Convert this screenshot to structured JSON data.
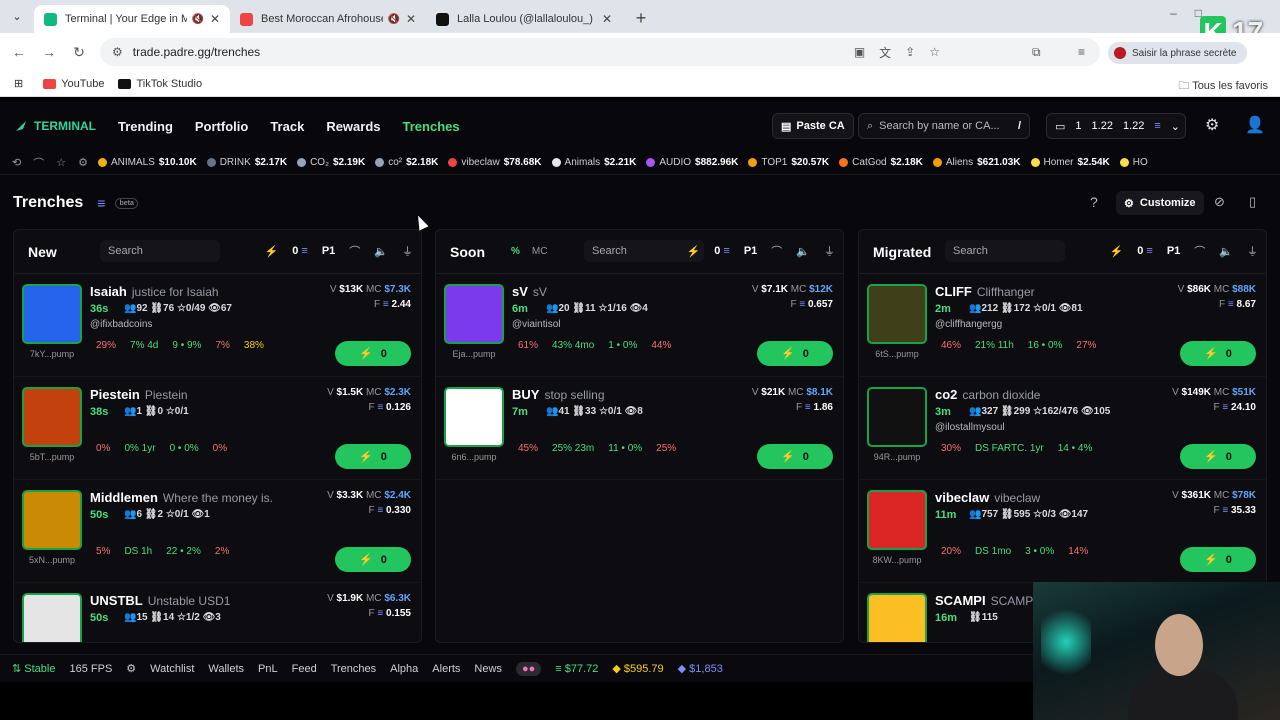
{
  "browser": {
    "tabs": [
      {
        "title": "Terminal | Your Edge in Me",
        "color": "#10b981",
        "active": true
      },
      {
        "title": "Best Moroccan Afrohouse M",
        "color": "#ef4444",
        "active": false
      },
      {
        "title": "Lalla Loulou (@lallaloulou_) est",
        "color": "#111111",
        "active": false
      }
    ],
    "url": "trade.padre.gg/trenches",
    "passkey_label": "Saisir la phrase secrète",
    "bookmarks": [
      {
        "label": "YouTube",
        "color": "#ef4444"
      },
      {
        "label": "TikTok Studio",
        "color": "#111111"
      }
    ],
    "all_bookmarks": "Tous les favoris",
    "badge_letter": "K",
    "badge_number": "17"
  },
  "app": {
    "logo": "TERMINAL",
    "nav": [
      "Trending",
      "Portfolio",
      "Track",
      "Rewards",
      "Trenches"
    ],
    "paste_label": "Paste CA",
    "search_placeholder": "Search by name or CA...",
    "search_key": "/",
    "wallet": {
      "count": "1",
      "v1": "1.22",
      "v2": "1.22"
    },
    "ticker": [
      {
        "name": "ANIMALS",
        "value": "$10.10K",
        "color": "#eab308"
      },
      {
        "name": "DRINK",
        "value": "$2.17K",
        "color": "#64748b"
      },
      {
        "name": "CO₂",
        "value": "$2.19K",
        "color": "#94a3b8"
      },
      {
        "name": "co²",
        "value": "$2.18K",
        "color": "#94a3b8"
      },
      {
        "name": "vibeclaw",
        "value": "$78.68K",
        "color": "#ef4444"
      },
      {
        "name": "Animals",
        "value": "$2.21K",
        "color": "#e5e7eb"
      },
      {
        "name": "AUDIO",
        "value": "$882.96K",
        "color": "#a855f7"
      },
      {
        "name": "TOP1",
        "value": "$20.57K",
        "color": "#f59e0b"
      },
      {
        "name": "CatGod",
        "value": "$2.18K",
        "color": "#f97316"
      },
      {
        "name": "Aliens",
        "value": "$621.03K",
        "color": "#f59e0b"
      },
      {
        "name": "Homer",
        "value": "$2.54K",
        "color": "#fde047"
      },
      {
        "name": "HO",
        "value": "",
        "color": "#fde047"
      }
    ],
    "trenches_title": "Trenches",
    "beta": "beta",
    "customize": "Customize",
    "columns": [
      {
        "title": "New",
        "search": "Search",
        "count": "0",
        "preset": "P1",
        "cards": [
          {
            "name": "Isaiah",
            "sub": "justice for Isaiah",
            "age": "36s",
            "stats": "👥92  ⛓76  ☆0/49  👁67",
            "handle": "@ifixbadcoins",
            "addr": "7kY...pump",
            "v": "$13K",
            "mc": "$7.3K",
            "f": "2.44",
            "pills": [
              "29%",
              "7% 4d",
              "9 • 9%",
              "7%",
              "38%"
            ],
            "buy": "0",
            "avatar": "#2563eb"
          },
          {
            "name": "Piestein",
            "sub": "Piestein",
            "age": "38s",
            "stats": "👥1  ⛓0  ☆0/1",
            "handle": "",
            "addr": "5bT...pump",
            "v": "$1.5K",
            "mc": "$2.3K",
            "f": "0.126",
            "pills": [
              "0%",
              "0% 1yr",
              "0 • 0%",
              "0%"
            ],
            "buy": "0",
            "avatar": "#c2410c"
          },
          {
            "name": "Middlemen",
            "sub": "Where the money is.",
            "age": "50s",
            "stats": "👥6  ⛓2  ☆0/1  👁1",
            "handle": "",
            "addr": "5xN...pump",
            "v": "$3.3K",
            "mc": "$2.4K",
            "f": "0.330",
            "pills": [
              "5%",
              "DS 1h",
              "22 • 2%",
              "2%"
            ],
            "buy": "0",
            "avatar": "#ca8a04"
          },
          {
            "name": "UNSTBL",
            "sub": "Unstable USD1",
            "age": "50s",
            "stats": "👥15  ⛓14  ☆1/2  👁3",
            "handle": "",
            "addr": "",
            "v": "$1.9K",
            "mc": "$6.3K",
            "f": "0.155",
            "pills": [],
            "buy": "",
            "avatar": "#e5e5e5"
          }
        ]
      },
      {
        "title": "Soon",
        "pct": "%",
        "mc": "MC",
        "search": "Search",
        "count": "0",
        "preset": "P1",
        "cards": [
          {
            "name": "sV",
            "sub": "sV",
            "age": "6m",
            "stats": "👥20  ⛓11  ☆1/16  👁4",
            "handle": "@viaintisol",
            "addr": "Eja...pump",
            "v": "$7.1K",
            "mc": "$12K",
            "f": "0.657",
            "pills": [
              "61%",
              "43% 4mo",
              "1 • 0%",
              "44%"
            ],
            "buy": "0",
            "avatar": "#7c3aed"
          },
          {
            "name": "BUY",
            "sub": "stop selling",
            "age": "7m",
            "stats": "👥41  ⛓33  ☆0/1  👁8",
            "handle": "",
            "addr": "6n6...pump",
            "v": "$21K",
            "mc": "$8.1K",
            "f": "1.86",
            "pills": [
              "45%",
              "25% 23m",
              "11 • 0%",
              "25%"
            ],
            "buy": "0",
            "avatar": "#ffffff"
          }
        ]
      },
      {
        "title": "Migrated",
        "search": "Search",
        "count": "0",
        "preset": "P1",
        "cards": [
          {
            "name": "CLIFF",
            "sub": "Cliffhanger",
            "age": "2m",
            "stats": "👥212  ⛓172  ☆0/1  👁81",
            "handle": "@cliffhangergg",
            "addr": "6tS...pump",
            "v": "$86K",
            "mc": "$88K",
            "f": "8.67",
            "pills": [
              "46%",
              "21% 11h",
              "16 • 0%",
              "27%"
            ],
            "buy": "0",
            "avatar": "#3f3f1a"
          },
          {
            "name": "co2",
            "sub": "carbon dioxide",
            "age": "3m",
            "stats": "👥327  ⛓299  ☆162/476  👁105",
            "handle": "@ilostallmysoul",
            "addr": "94R...pump",
            "v": "$149K",
            "mc": "$51K",
            "f": "24.10",
            "pills": [
              "30%",
              "DS FARTC. 1yr",
              "14 • 4%"
            ],
            "buy": "0",
            "avatar": "#111111"
          },
          {
            "name": "vibeclaw",
            "sub": "vibeclaw",
            "age": "11m",
            "stats": "👥757  ⛓595  ☆0/3  👁147",
            "handle": "",
            "addr": "8KW...pump",
            "v": "$361K",
            "mc": "$78K",
            "f": "35.33",
            "pills": [
              "20%",
              "DS 1mo",
              "3 • 0%",
              "14%"
            ],
            "buy": "0",
            "avatar": "#dc2626"
          },
          {
            "name": "SCAMPI",
            "sub": "SCAMPI",
            "age": "16m",
            "stats": "⛓115",
            "handle": "",
            "addr": "",
            "v": "",
            "mc": "",
            "f": "",
            "pills": [],
            "buy": "",
            "avatar": "#fbbf24"
          }
        ]
      }
    ],
    "bottom": {
      "stable": "Stable",
      "fps": "165 FPS",
      "items": [
        "Watchlist",
        "Wallets",
        "PnL",
        "Feed",
        "Trenches",
        "Alpha",
        "Alerts",
        "News"
      ],
      "prices": [
        "$77.72",
        "$595.79",
        "$1,853"
      ]
    }
  }
}
